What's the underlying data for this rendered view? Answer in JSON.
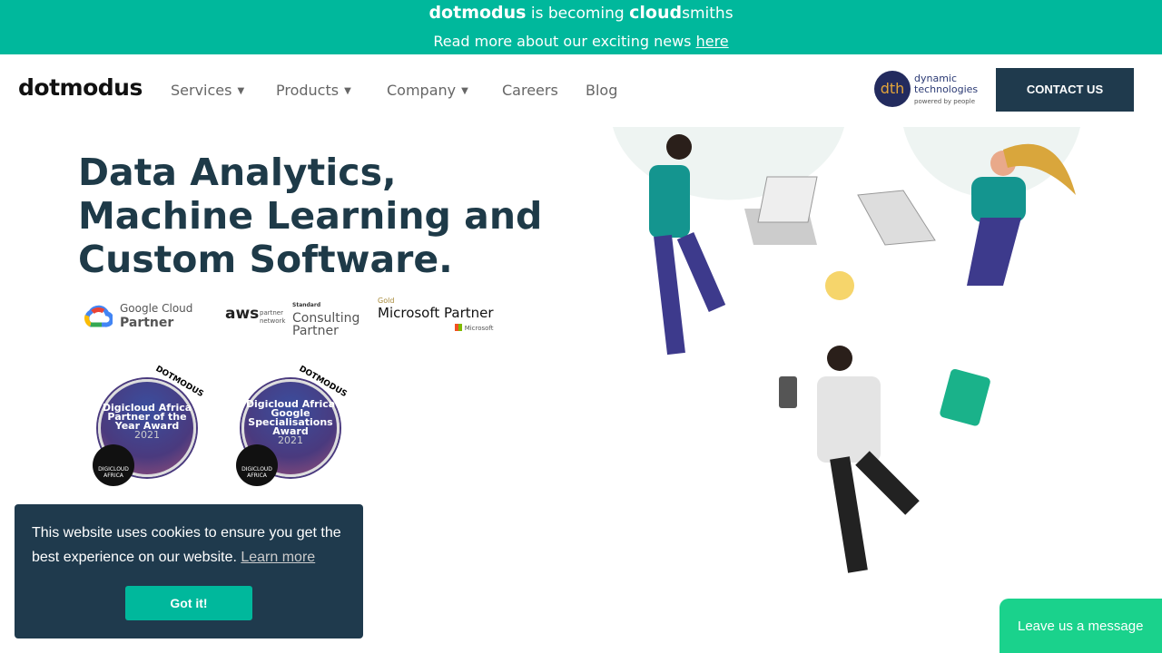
{
  "banner": {
    "brand_old": "dotmodus",
    "becoming": "is becoming",
    "brand_new_bold": "cloud",
    "brand_new_rest": "smiths",
    "news": "Read more about our exciting news ",
    "news_link": "here"
  },
  "nav": {
    "logo": "dotmodus",
    "items": [
      {
        "label": "Services",
        "dropdown": true
      },
      {
        "label": "Products",
        "dropdown": true
      },
      {
        "label": "Company",
        "dropdown": true
      },
      {
        "label": "Careers"
      },
      {
        "label": "Blog"
      }
    ],
    "caret": "▼",
    "partner_logo": {
      "mark": "dth",
      "line1": "dynamic",
      "line2": "technologies",
      "line3": "powered by people"
    },
    "contact": "CONTACT US"
  },
  "hero": {
    "title": "Data Analytics, Machine Learning and Custom Software."
  },
  "partners": {
    "google": {
      "line1": "Google Cloud",
      "line2": "Partner"
    },
    "aws": {
      "logo": "aws",
      "network": "partner network",
      "tier": "Standard",
      "line1": "Consulting",
      "line2": "Partner"
    },
    "microsoft": {
      "tier": "Gold",
      "line1": "Microsoft Partner",
      "brand": "Microsoft"
    }
  },
  "awards": [
    {
      "arc": "DOTMODUS",
      "title": "Digicloud Africa Partner of the Year Award",
      "year": "2021",
      "seal": "DIGICLOUD AFRICA"
    },
    {
      "arc": "DOTMODUS",
      "title": "Digicloud Africa Google Specialisations Award",
      "year": "2021",
      "seal": "DIGICLOUD AFRICA"
    }
  ],
  "cookie": {
    "text": "This website uses cookies to ensure you get the best experience on our website. ",
    "link": "Learn more",
    "button": "Got it!"
  },
  "chat": {
    "label": "Leave us a message"
  },
  "colors": {
    "accent": "#00b89c",
    "dark": "#1f3a4d",
    "chat": "#1ad28c"
  }
}
